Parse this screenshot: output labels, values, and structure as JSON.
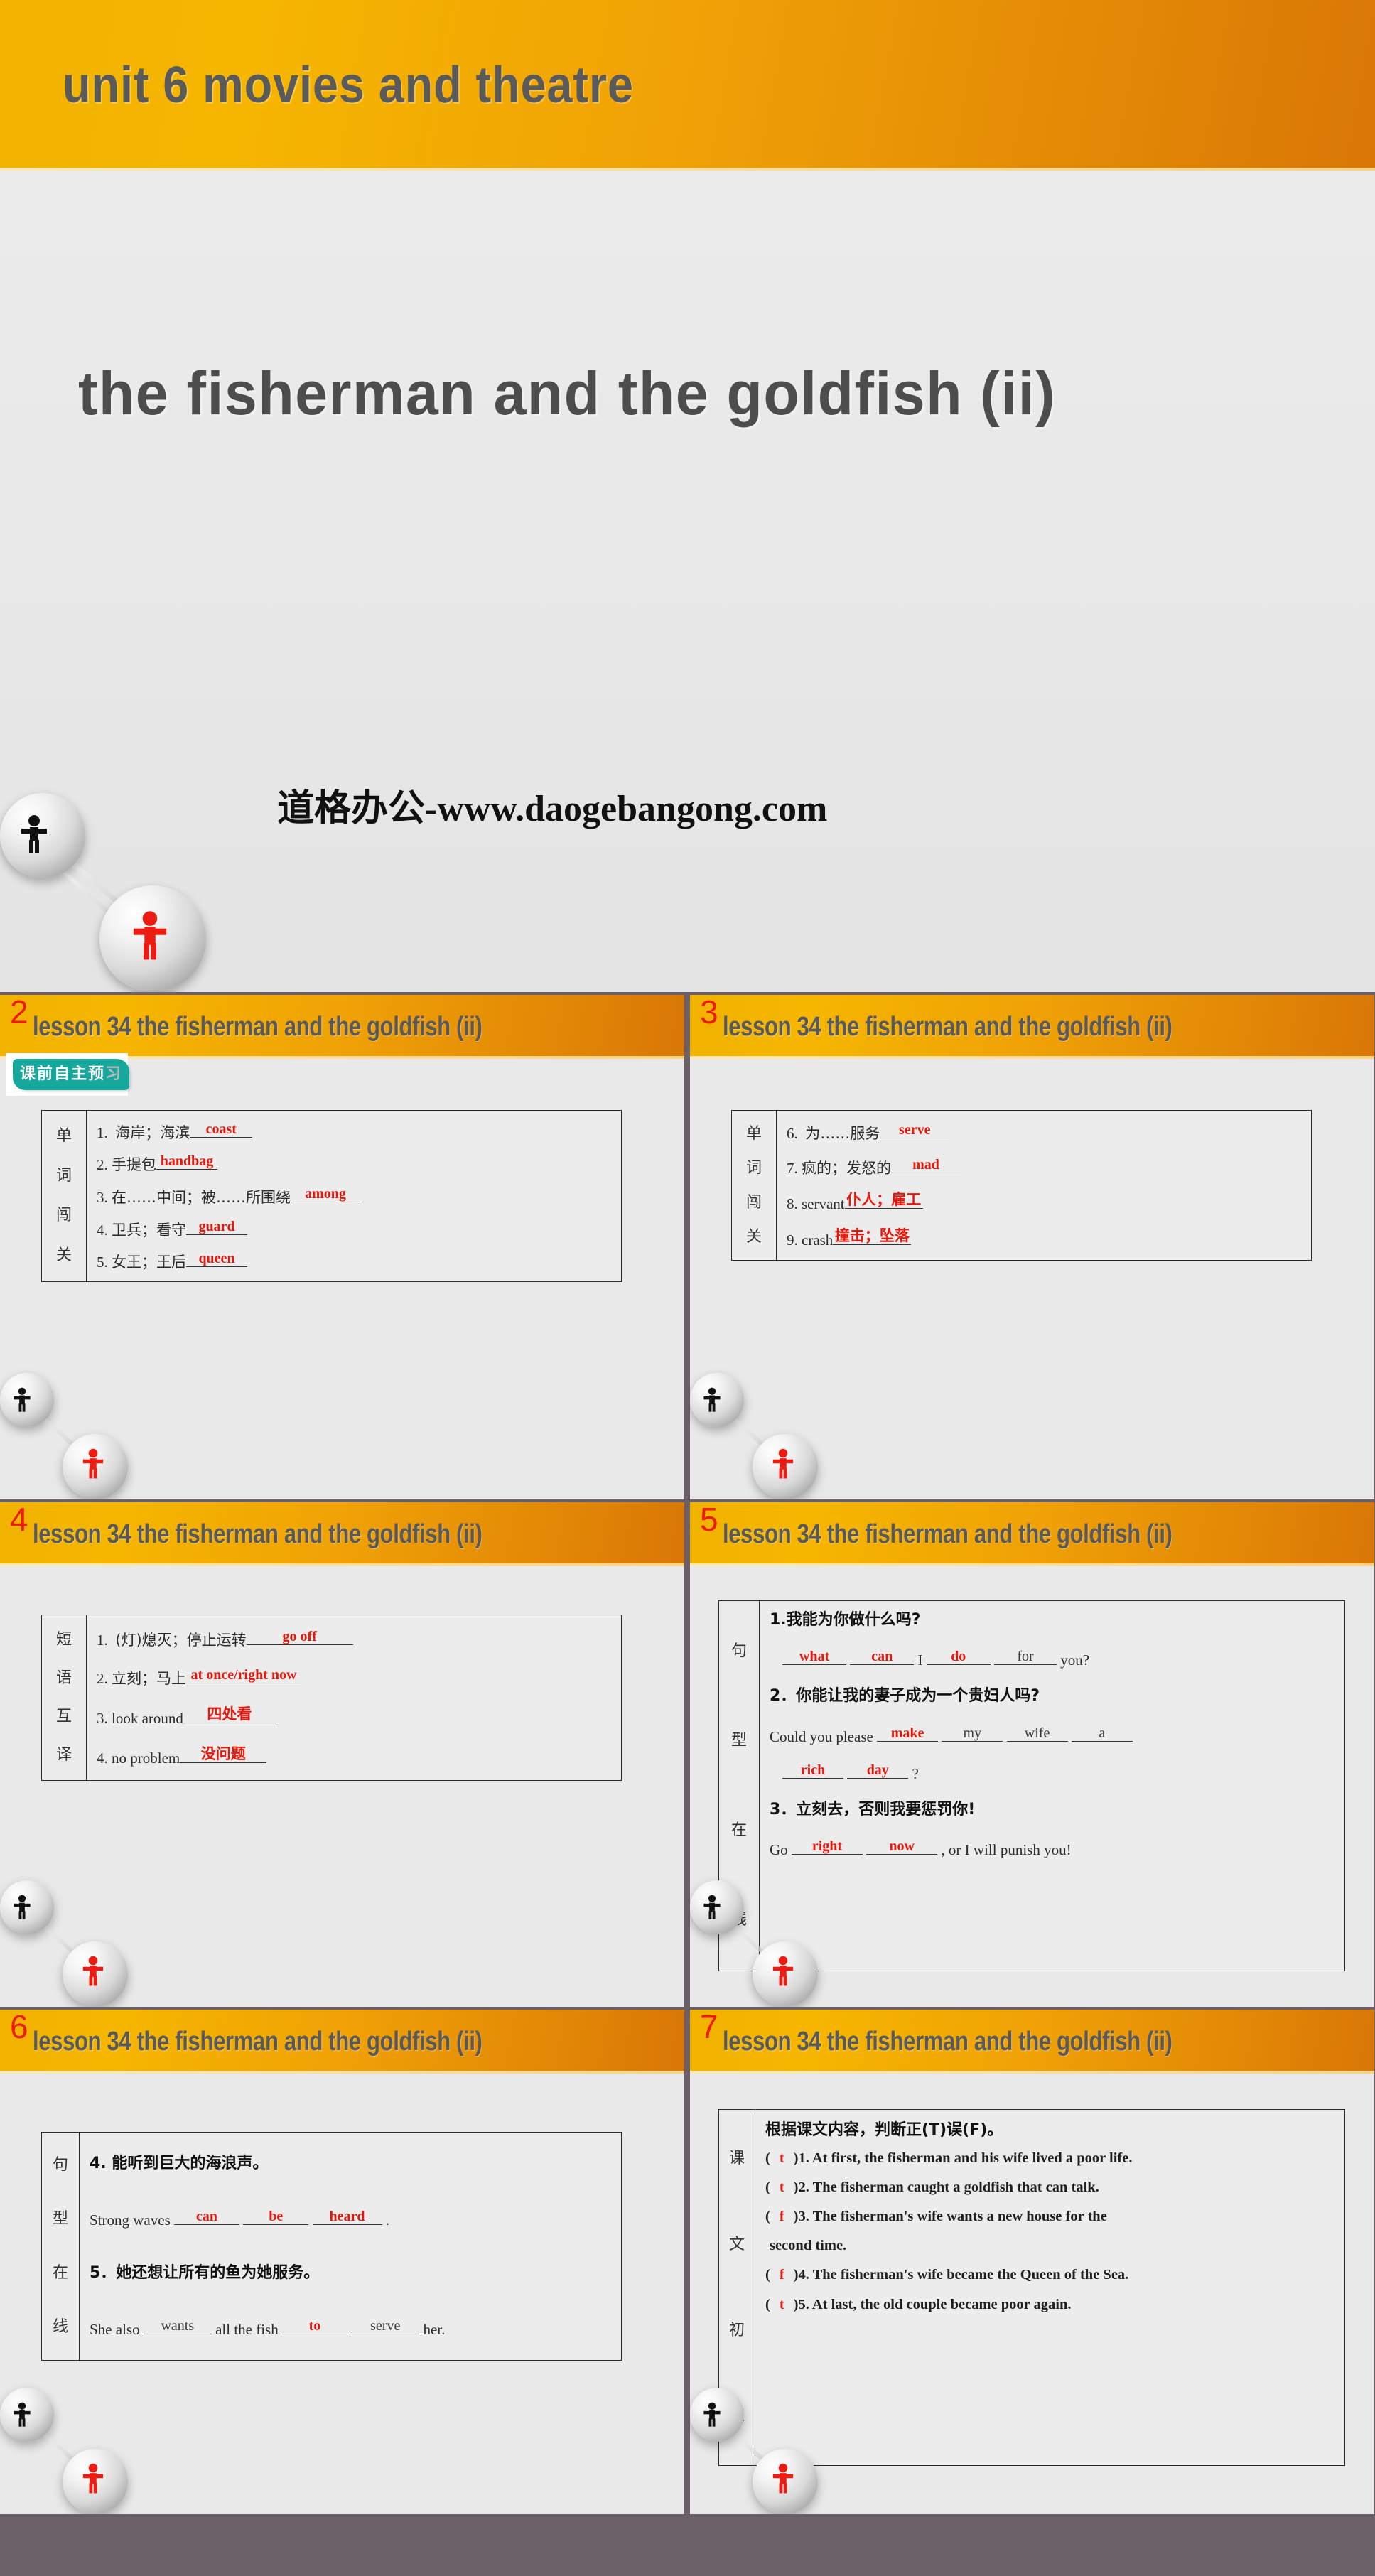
{
  "slide1": {
    "banner_title": "unit 6   movies and theatre",
    "main_title": "the fisherman and the goldfish (ii)",
    "watermark": "道格办公-www.daogebangong.com"
  },
  "lesson_title": "lesson 34   the fisherman and the goldfish (ii)",
  "slide2": {
    "number": "2",
    "tag": "课前自主预",
    "tag_faded": "习",
    "label": [
      "单",
      "词",
      "闯",
      "关"
    ],
    "rows": [
      {
        "no": "1.",
        "prompt": "海岸；海滨",
        "answer": "coast",
        "answer_lang": "en"
      },
      {
        "no": "2.",
        "prompt": "手提包",
        "answer": "handbag",
        "answer_lang": "en"
      },
      {
        "no": "3.",
        "prompt": "在……中间；被……所围绕",
        "answer": "among",
        "answer_lang": "en"
      },
      {
        "no": "4.",
        "prompt": "卫兵；看守",
        "answer": "guard",
        "answer_lang": "en"
      },
      {
        "no": "5.",
        "prompt": "女王；王后",
        "answer": "queen",
        "answer_lang": "en"
      }
    ]
  },
  "slide3": {
    "number": "3",
    "label": [
      "单",
      "词",
      "闯",
      "关"
    ],
    "rows": [
      {
        "no": "6.",
        "prompt": "为……服务",
        "answer": "serve",
        "answer_lang": "en"
      },
      {
        "no": "7.",
        "prompt": "疯的；发怒的",
        "answer": "mad",
        "answer_lang": "en"
      },
      {
        "no": "8.",
        "prompt": "servant",
        "answer": "仆人；雇工",
        "answer_lang": "cn"
      },
      {
        "no": "9.",
        "prompt": "crash",
        "answer": "撞击；坠落",
        "answer_lang": "cn"
      }
    ]
  },
  "slide4": {
    "number": "4",
    "label": [
      "短",
      "语",
      "互",
      "译"
    ],
    "rows": [
      {
        "no": "1.",
        "prompt": "(灯)熄灭；停止运转",
        "answer": "go off",
        "answer_lang": "en"
      },
      {
        "no": "2.",
        "prompt": "立刻；马上",
        "answer": "at once/right now",
        "answer_lang": "en"
      },
      {
        "no": "3.",
        "prompt": "look around",
        "answer": "四处看",
        "answer_lang": "cn"
      },
      {
        "no": "4.",
        "prompt": "no problem",
        "answer": "没问题",
        "answer_lang": "cn"
      }
    ]
  },
  "slide5": {
    "number": "5",
    "label": [
      "句",
      "型",
      "在",
      "线"
    ],
    "items": [
      {
        "cn": "1.我能为你做什么吗?",
        "segments": [
          {
            "type": "blank",
            "text": "what",
            "color": "red",
            "w": 90
          },
          {
            "type": "blank",
            "text": "can",
            "color": "red",
            "w": 90
          },
          {
            "type": "text",
            "text": "I"
          },
          {
            "type": "blank",
            "text": "do",
            "color": "red",
            "w": 90
          },
          {
            "type": "blank",
            "text": "for",
            "color": "grey",
            "w": 88
          },
          {
            "type": "text",
            "text": "you?"
          }
        ]
      },
      {
        "cn": "2．你能让我的妻子成为一个贵妇人吗?",
        "segments": [
          {
            "type": "text",
            "text": "Could you please"
          },
          {
            "type": "blank",
            "text": "make",
            "color": "red",
            "w": 86
          },
          {
            "type": "blank",
            "text": "my",
            "color": "grey",
            "w": 86
          },
          {
            "type": "blank",
            "text": "wife",
            "color": "grey",
            "w": 86
          },
          {
            "type": "blank",
            "text": "a",
            "color": "grey",
            "w": 86
          }
        ],
        "segments2": [
          {
            "type": "blank",
            "text": "rich",
            "color": "red",
            "w": 86
          },
          {
            "type": "blank",
            "text": "day",
            "color": "red",
            "w": 86
          },
          {
            "type": "text",
            "text": "?"
          }
        ]
      },
      {
        "cn": "3．立刻去，否则我要惩罚你!",
        "segments": [
          {
            "type": "text",
            "text": "Go"
          },
          {
            "type": "blank",
            "text": "right",
            "color": "red",
            "w": 100
          },
          {
            "type": "blank",
            "text": "now",
            "color": "red",
            "w": 100
          },
          {
            "type": "text",
            "text": ",  or I will punish you!"
          }
        ]
      }
    ]
  },
  "slide6": {
    "number": "6",
    "label": [
      "句",
      "型",
      "在",
      "线"
    ],
    "items": [
      {
        "cn": "4. 能听到巨大的海浪声。",
        "segments": [
          {
            "type": "text",
            "text": "Strong waves"
          },
          {
            "type": "blank",
            "text": "can",
            "color": "red",
            "w": 92
          },
          {
            "type": "blank",
            "text": "be",
            "color": "red",
            "w": 92
          },
          {
            "type": "blank",
            "text": "heard",
            "color": "red",
            "w": 98
          },
          {
            "type": "text",
            "text": "."
          }
        ]
      },
      {
        "cn": "5．她还想让所有的鱼为她服务。",
        "segments": [
          {
            "type": "text",
            "text": "She also"
          },
          {
            "type": "blank",
            "text": "wants",
            "color": "grey",
            "w": 96
          },
          {
            "type": "text",
            "text": "all the fish"
          },
          {
            "type": "blank",
            "text": "to",
            "color": "red",
            "w": 92
          },
          {
            "type": "blank",
            "text": "serve",
            "color": "grey",
            "w": 96
          },
          {
            "type": "text",
            "text": "her."
          }
        ]
      }
    ]
  },
  "slide7": {
    "number": "7",
    "label": [
      "课",
      "文",
      "初",
      "探"
    ],
    "heading": "根据课文内容，判断正(T)误(F)。",
    "items": [
      {
        "mark": "t",
        "text": ")1. At first, the fisherman and his wife lived a poor life."
      },
      {
        "mark": "t",
        "text": ")2. The fisherman caught a goldfish that can talk."
      },
      {
        "mark": "f",
        "text": ")3. The fisherman's wife wants a new house for the"
      },
      {
        "mark": "",
        "text": "second time.",
        "continuation": true
      },
      {
        "mark": "f",
        "text": ")4. The fisherman's wife became the Queen of the Sea."
      },
      {
        "mark": "t",
        "text": ")5. At last, the old couple became poor again."
      }
    ]
  },
  "colors": {
    "answer_red": "#e8170c",
    "slide_number_red": "#ee1c10",
    "title_gray": "#595959",
    "banner_orange_light": "#f6b600",
    "banner_orange_dark": "#d97706",
    "tag_teal": "#16a79d",
    "deck_divider": "#6b6068"
  }
}
